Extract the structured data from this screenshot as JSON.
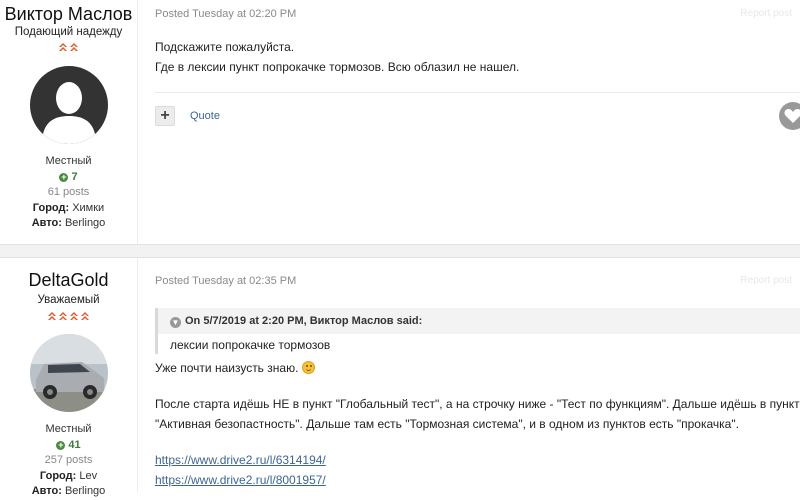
{
  "posts": [
    {
      "author": "Виктор Маслов",
      "rank_title": "Подающий надежду",
      "rank_pips": "^^",
      "member_group": "Местный",
      "reputation": "7",
      "posts_count": "61 posts",
      "city_label": "Город:",
      "city": "Химки",
      "car_label": "Авто:",
      "car": "Berlingo",
      "posted": "Posted Tuesday at 02:20 PM",
      "report": "Report post",
      "lines": [
        "Подскажите пожалуйста.",
        "Где в лексии пункт попрокачке тормозов. Всю облазил не нашел."
      ],
      "quote_label": "Quote",
      "add_label": "+"
    },
    {
      "author": "DeltaGold",
      "rank_title": "Уважаемый",
      "rank_pips": "^^^^",
      "member_group": "Местный",
      "reputation": "41",
      "posts_count": "257 posts",
      "city_label": "Город:",
      "city": "Lev",
      "car_label": "Авто:",
      "car": "Berlingo",
      "posted": "Posted Tuesday at 02:35 PM",
      "report": "Report post",
      "quote": {
        "header": "On 5/7/2019 at 2:20 PM, Виктор Маслов said:",
        "text": "лексии попрокачке тормозов"
      },
      "line1": "Уже почти наизусть знаю.",
      "para1": "После старта идёшь НЕ в пункт \"Глобальный тест\", а на строчку ниже - \"Тест по функциям\". Дальше идёшь в пункт",
      "para2": "\"Активная безопастность\". Дальше там есть \"Тормозная система\", и в одном из пунктов есть \"прокачка\".",
      "links": [
        "https://www.drive2.ru/l/6314194/",
        "https://www.drive2.ru/l/8001957/"
      ]
    }
  ],
  "colors": {
    "accent": "#3d6594",
    "rep": "#3d7a3a",
    "pips": "#e0592c"
  }
}
